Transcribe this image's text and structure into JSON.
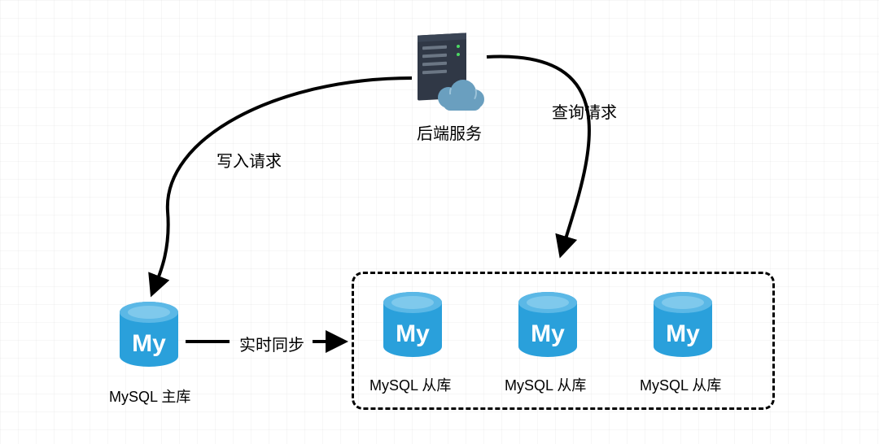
{
  "server_label": "后端服务",
  "write_request_label": "写入请求",
  "query_request_label": "查询请求",
  "sync_label": "实时同步",
  "master_label": "MySQL 主库",
  "slave_label_1": "MySQL 从库",
  "slave_label_2": "MySQL 从库",
  "slave_label_3": "MySQL 从库",
  "colors": {
    "mysql_blue": "#2aa0db",
    "server_dark": "#303846",
    "cloud": "#6a9fbf"
  }
}
